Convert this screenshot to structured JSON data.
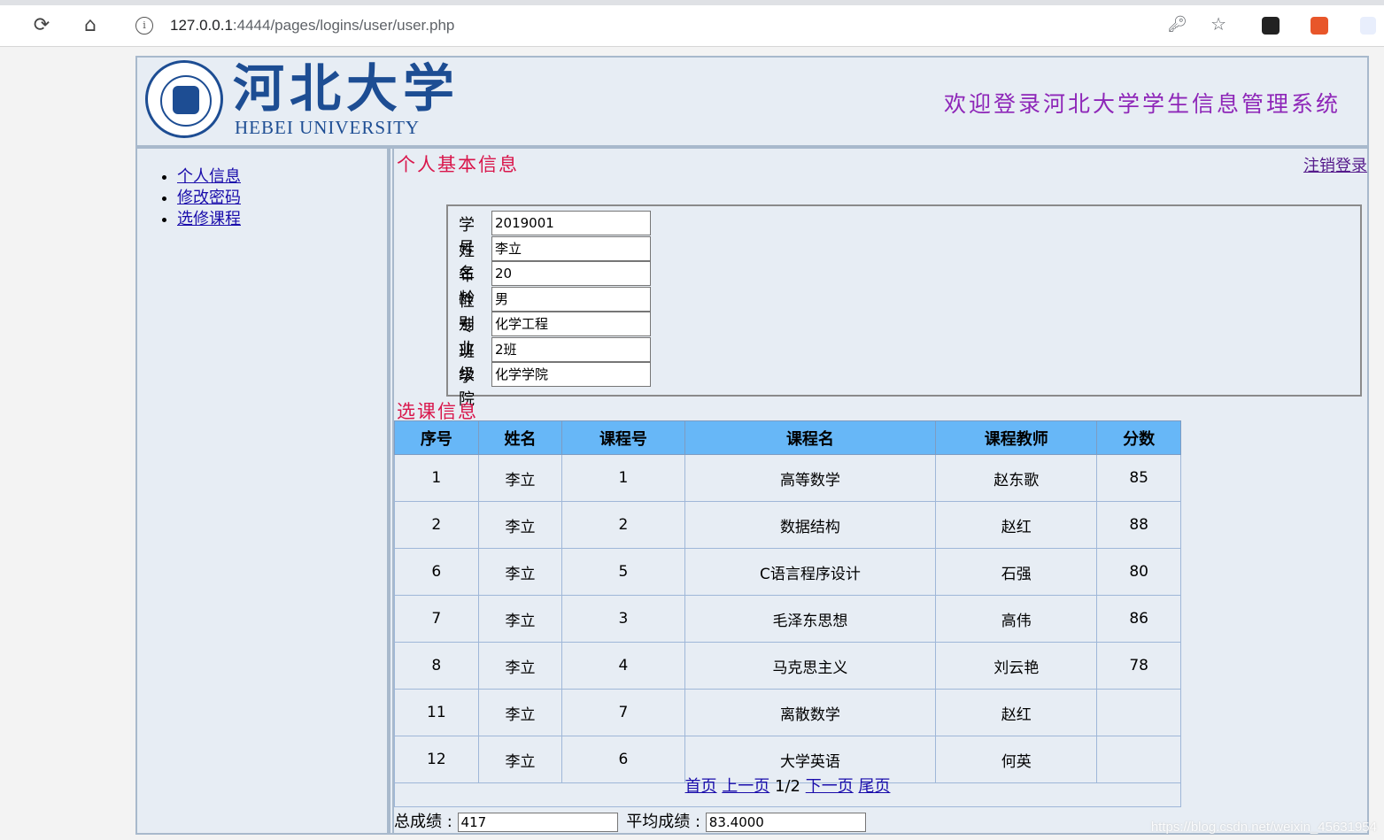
{
  "browser": {
    "url_host": "127.0.0.1",
    "url_rest": ":4444/pages/logins/user/user.php"
  },
  "header": {
    "logo_cn": "河北大学",
    "logo_en": "HEBEI UNIVERSITY",
    "welcome": "欢迎登录河北大学学生信息管理系统"
  },
  "nav": {
    "items": [
      {
        "label": "个人信息"
      },
      {
        "label": "修改密码"
      },
      {
        "label": "选修课程"
      }
    ]
  },
  "main": {
    "info_title": "个人基本信息",
    "logout": "注销登录",
    "fields": [
      {
        "label": "学号",
        "value": "2019001"
      },
      {
        "label": "姓名",
        "value": "李立"
      },
      {
        "label": "年龄",
        "value": "20"
      },
      {
        "label": "性别",
        "value": "男"
      },
      {
        "label": "专业",
        "value": "化学工程"
      },
      {
        "label": "班级",
        "value": "2班"
      },
      {
        "label": "学院",
        "value": "化学学院"
      }
    ],
    "course_title": "选课信息",
    "table": {
      "headers": [
        "序号",
        "姓名",
        "课程号",
        "课程名",
        "课程教师",
        "分数"
      ],
      "rows": [
        [
          "1",
          "李立",
          "1",
          "高等数学",
          "赵东歌",
          "85"
        ],
        [
          "2",
          "李立",
          "2",
          "数据结构",
          "赵红",
          "88"
        ],
        [
          "6",
          "李立",
          "5",
          "C语言程序设计",
          "石强",
          "80"
        ],
        [
          "7",
          "李立",
          "3",
          "毛泽东思想",
          "高伟",
          "86"
        ],
        [
          "8",
          "李立",
          "4",
          "马克思主义",
          "刘云艳",
          "78"
        ],
        [
          "11",
          "李立",
          "7",
          "离散数学",
          "赵红",
          ""
        ],
        [
          "12",
          "李立",
          "6",
          "大学英语",
          "何英",
          ""
        ]
      ]
    },
    "pager": {
      "first": "首页",
      "prev": "上一页",
      "page": "1/2",
      "next": "下一页",
      "last": "尾页"
    },
    "summary": {
      "total_label": "总成绩 :",
      "total_value": "417",
      "avg_label": "平均成绩 :",
      "avg_value": "83.4000"
    }
  },
  "watermark": "https://blog.csdn.net/weixin_45631954"
}
